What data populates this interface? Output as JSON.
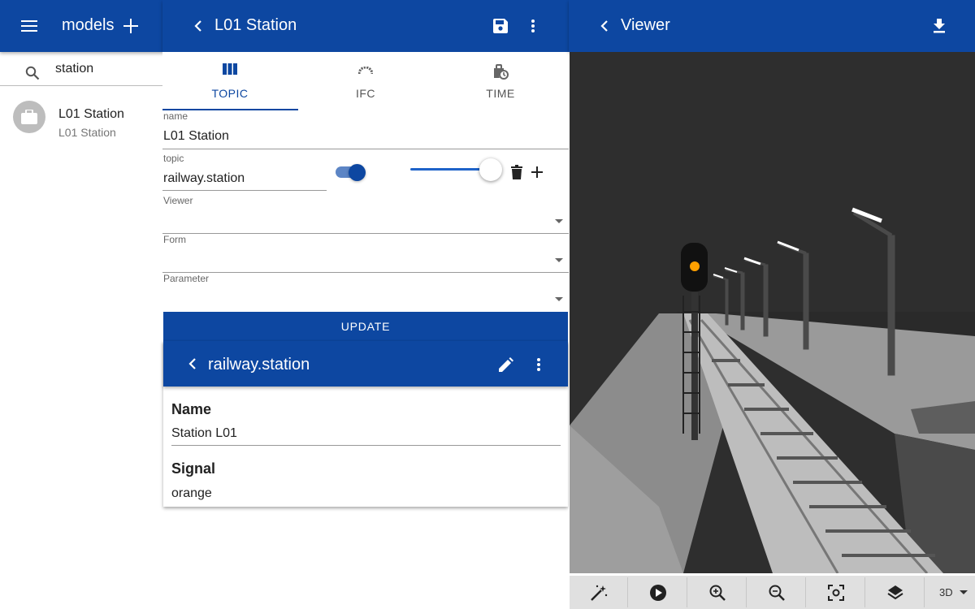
{
  "colors": {
    "primary": "#0d47a1",
    "accent": "#ffa000",
    "viewer_bg": "#2e2e2e"
  },
  "left": {
    "header": {
      "title": "models",
      "menu_icon": "menu-icon",
      "add_icon": "plus-icon"
    },
    "search": {
      "value": "station",
      "icon": "search-icon"
    },
    "items": [
      {
        "primary": "L01 Station",
        "secondary": "L01 Station",
        "icon": "briefcase-icon"
      }
    ]
  },
  "middle": {
    "header": {
      "title": "L01 Station",
      "back_icon": "chevron-left-icon",
      "save_icon": "save-icon",
      "more_icon": "more-vert-icon"
    },
    "tabs": [
      {
        "label": "TOPIC",
        "icon": "view-column-icon",
        "active": true
      },
      {
        "label": "IFC",
        "icon": "ifc-icon",
        "active": false
      },
      {
        "label": "TIME",
        "icon": "clock-icon",
        "active": false
      }
    ],
    "fields": {
      "name": {
        "label": "name",
        "value": "L01 Station"
      },
      "topic": {
        "label": "topic",
        "value": "railway.station",
        "toggle_on": true,
        "slider_value": 1.0
      },
      "viewer": {
        "label": "Viewer",
        "value": ""
      },
      "form": {
        "label": "Form",
        "value": ""
      },
      "parameter": {
        "label": "Parameter",
        "value": ""
      }
    },
    "update_label": "UPDATE",
    "card": {
      "title": "railway.station",
      "rows": [
        {
          "label": "Name",
          "value": "Station L01"
        },
        {
          "label": "Signal",
          "value": "orange"
        }
      ]
    }
  },
  "right": {
    "header": {
      "title": "Viewer",
      "back_icon": "chevron-left-icon",
      "download_icon": "download-icon"
    },
    "toolbar": {
      "buttons": [
        "magic-wand-icon",
        "play-icon",
        "zoom-in-icon",
        "zoom-out-icon",
        "focus-icon",
        "layers-icon"
      ],
      "mode": "3D"
    }
  }
}
